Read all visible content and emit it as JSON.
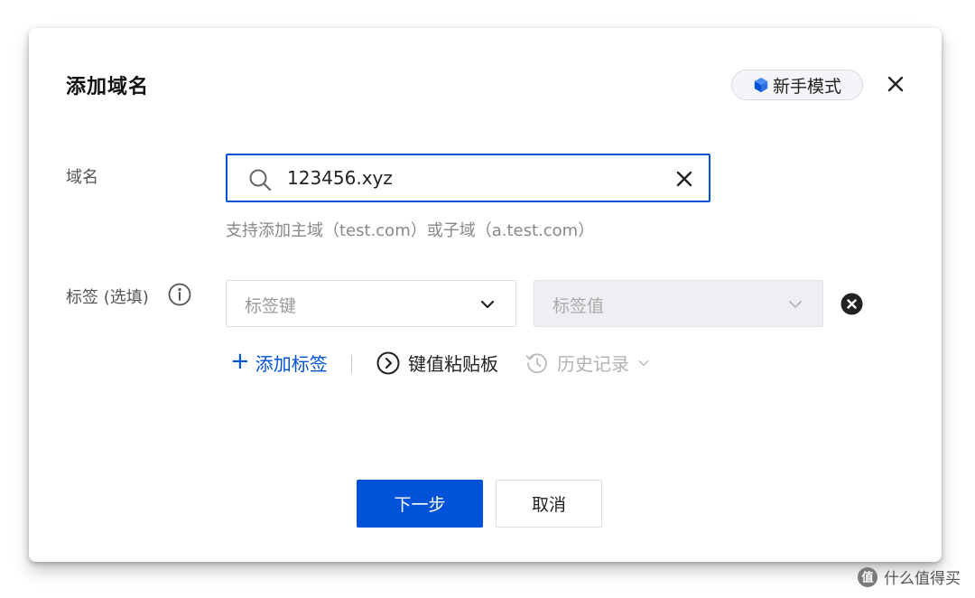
{
  "dialog": {
    "title": "添加域名",
    "mode_button": "新手模式"
  },
  "form": {
    "domain_label": "域名",
    "domain_value": "123456.xyz",
    "domain_hint": "支持添加主域（test.com）或子域（a.test.com）",
    "tag_label": "标签 (选填)",
    "tag_key_placeholder": "标签键",
    "tag_value_placeholder": "标签值"
  },
  "tag_actions": {
    "add_tag": "添加标签",
    "paste_board": "键值粘贴板",
    "history": "历史记录"
  },
  "footer": {
    "next": "下一步",
    "cancel": "取消"
  },
  "watermark": {
    "text": "什么值得买"
  },
  "colors": {
    "primary": "#0052d9",
    "disabled_bg": "#eeeff2"
  }
}
